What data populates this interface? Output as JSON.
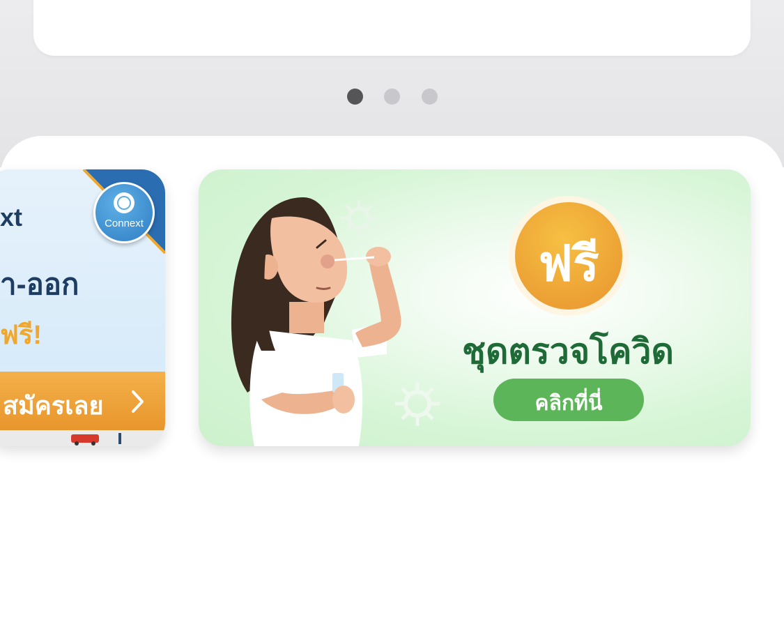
{
  "quick_actions": [
    {
      "icon": "deposit-icon",
      "label": ""
    },
    {
      "icon": "transfer-icon",
      "label": ""
    }
  ],
  "carousel": {
    "total": 3,
    "active_index": 0
  },
  "banners": [
    {
      "id": "connext",
      "brand": "Connext",
      "title_fragment": "xt",
      "headline_fragment": "า-ออก",
      "free_label": "ฟรี!",
      "button_label": "สมัครเลย"
    },
    {
      "id": "covid-test",
      "badge_label": "ฟรี",
      "title": "ชุดตรวจโควิด",
      "button_label": "คลิกที่นี่"
    }
  ],
  "colors": {
    "brand_blue": "#2e7dc4",
    "accent_orange": "#e8962c",
    "covid_green": "#1f6b37",
    "button_green": "#5db55a"
  }
}
